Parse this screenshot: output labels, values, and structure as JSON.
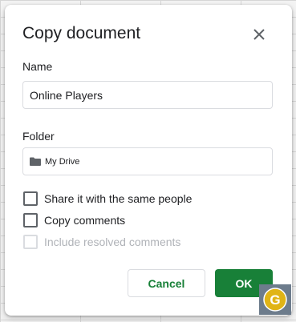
{
  "dialog": {
    "title": "Copy document",
    "close_icon": "close-icon"
  },
  "name_field": {
    "label": "Name",
    "value": "Online Players"
  },
  "folder_field": {
    "label": "Folder",
    "icon": "folder-icon",
    "value": "My Drive"
  },
  "options": [
    {
      "label": "Share it with the same people",
      "checked": false,
      "disabled": false
    },
    {
      "label": "Copy comments",
      "checked": false,
      "disabled": false
    },
    {
      "label": "Include resolved comments",
      "checked": false,
      "disabled": true
    }
  ],
  "buttons": {
    "cancel_label": "Cancel",
    "ok_label": "OK"
  },
  "colors": {
    "accent": "#188038",
    "text": "#202124",
    "border": "#dadce0",
    "disabled_text": "#b0b3b8"
  },
  "watermark": {
    "icon": "logo-badge",
    "text": "G"
  }
}
